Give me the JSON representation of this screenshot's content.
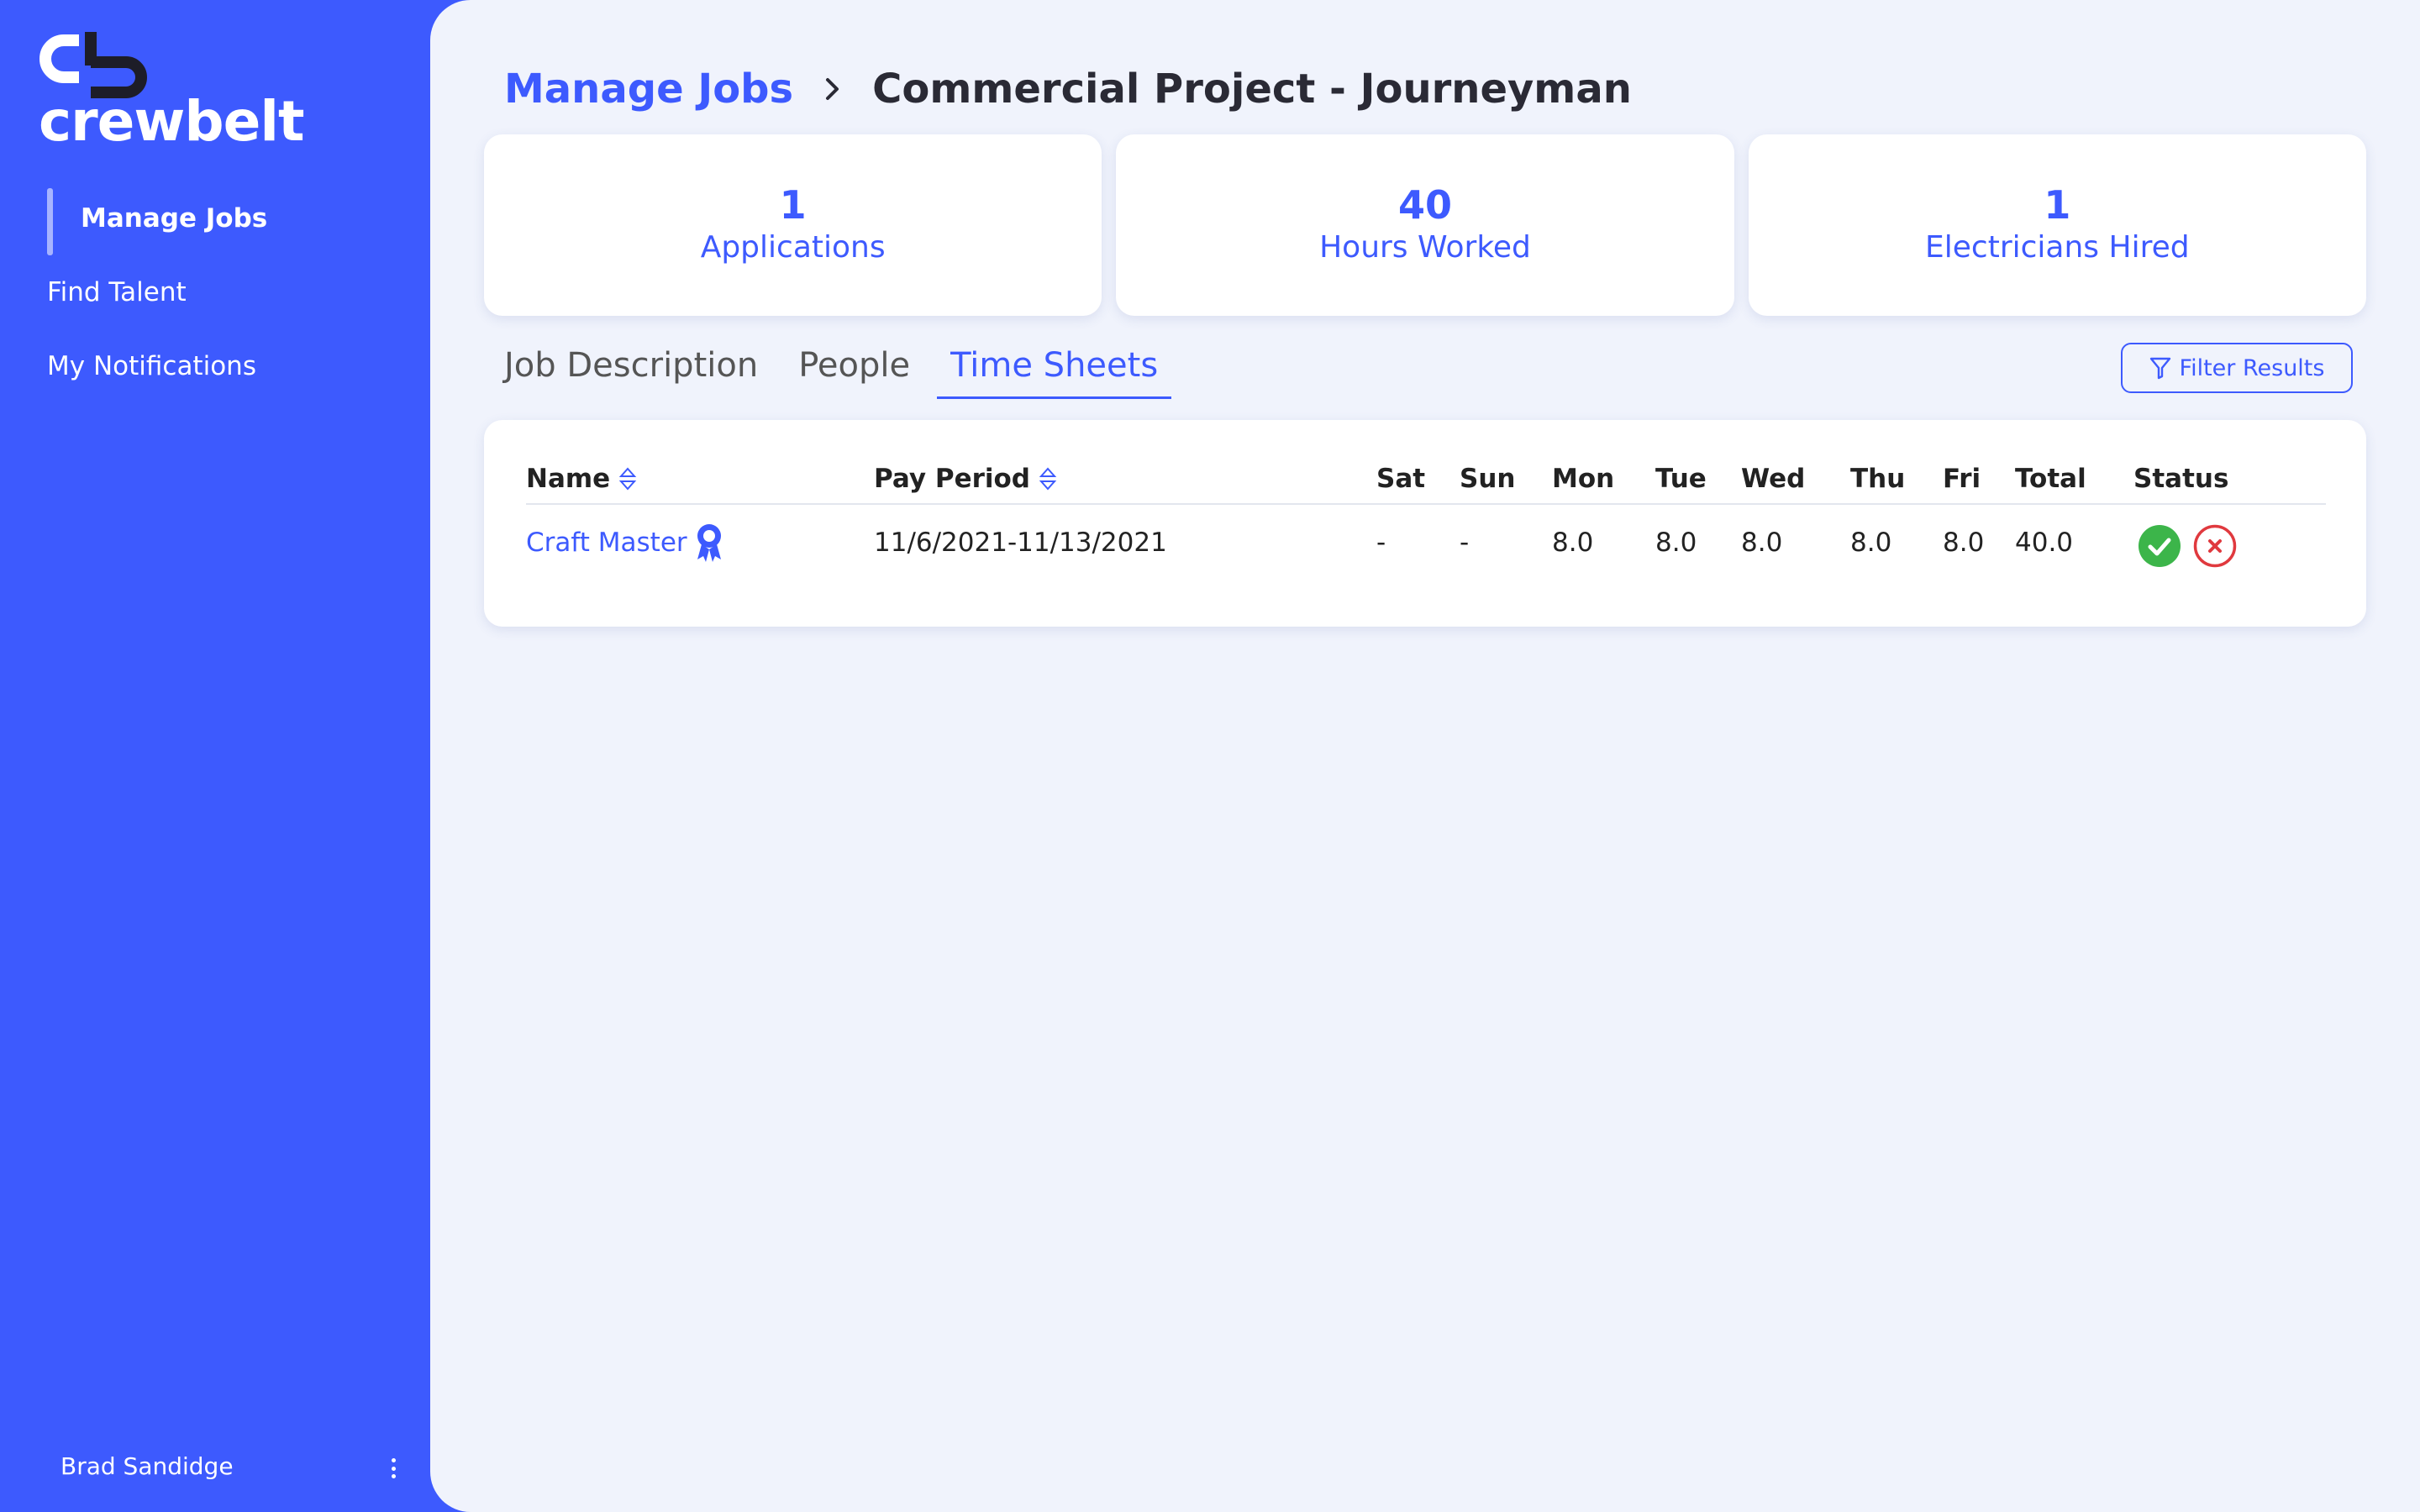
{
  "app": {
    "logo_text": "crewbelt",
    "brand_color": "#3d5afe"
  },
  "sidebar": {
    "items": [
      {
        "label": "Manage Jobs",
        "active": true
      },
      {
        "label": "Find Talent",
        "active": false
      },
      {
        "label": "My Notifications",
        "active": false
      }
    ],
    "user_name": "Brad Sandidge",
    "user_menu_icon": "kebab-menu-icon"
  },
  "breadcrumb": {
    "parent": "Manage Jobs",
    "separator_icon": "chevron-right-icon",
    "current": "Commercial Project - Journeyman"
  },
  "stats": [
    {
      "value": "1",
      "label": "Applications"
    },
    {
      "value": "40",
      "label": "Hours Worked"
    },
    {
      "value": "1",
      "label": "Electricians Hired"
    }
  ],
  "tabs": [
    {
      "label": "Job Description",
      "active": false
    },
    {
      "label": "People",
      "active": false
    },
    {
      "label": "Time Sheets",
      "active": true
    }
  ],
  "filter": {
    "label": "Filter Results",
    "icon": "funnel-icon"
  },
  "timesheet": {
    "columns": [
      "Name",
      "Pay Period",
      "Sat",
      "Sun",
      "Mon",
      "Tue",
      "Wed",
      "Thu",
      "Fri",
      "Total",
      "Status"
    ],
    "rows": [
      {
        "name": "Craft Master",
        "badge_icon": "award-ribbon-icon",
        "pay_period": "11/6/2021-11/13/2021",
        "sat": "-",
        "sun": "-",
        "mon": "8.0",
        "tue": "8.0",
        "wed": "8.0",
        "thu": "8.0",
        "fri": "8.0",
        "total": "40.0",
        "status_actions": [
          "approve-check-icon",
          "reject-x-icon"
        ]
      }
    ]
  },
  "colors": {
    "approve": "#3cb54a",
    "reject": "#e0393e",
    "background": "#f0f3fc"
  }
}
